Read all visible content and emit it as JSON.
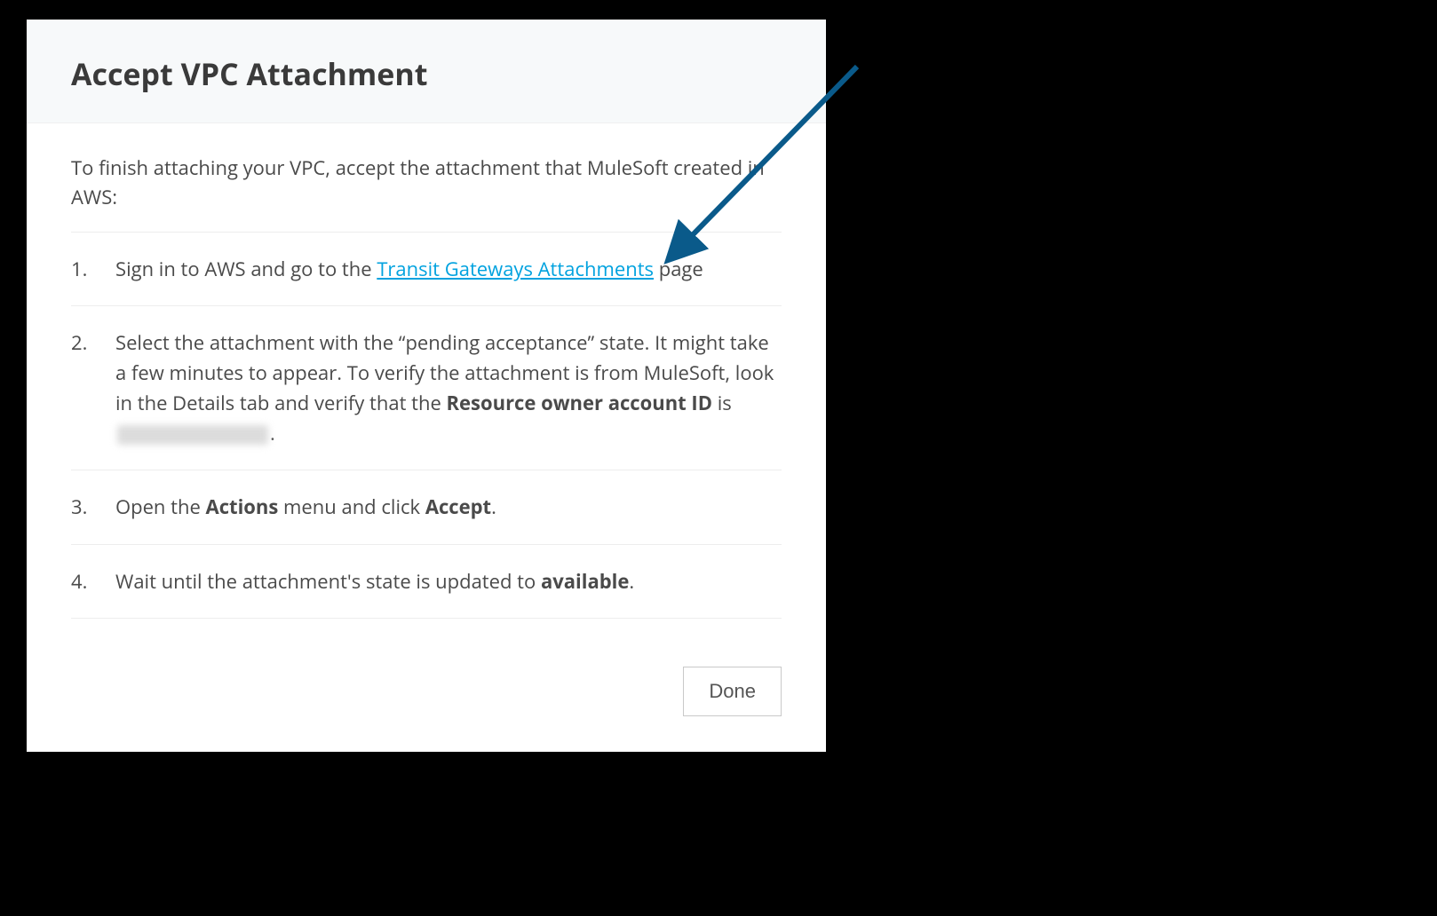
{
  "dialog": {
    "title": "Accept VPC Attachment",
    "intro": "To finish attaching your VPC, accept the attachment that MuleSoft created in AWS:"
  },
  "steps": {
    "s1": {
      "num": "1.",
      "pre": "Sign in to AWS and go to the ",
      "link": "Transit Gateways Attachments",
      "post": " page"
    },
    "s2": {
      "num": "2.",
      "pre": "Select the attachment with the “pending acceptance” state. It might take a few minutes to appear. To verify the attachment is from MuleSoft, look in the Details tab and verify that the ",
      "bold": "Resource owner account ID",
      "mid": " is ",
      "post": "."
    },
    "s3": {
      "num": "3.",
      "pre": "Open the ",
      "bold1": "Actions",
      "mid": " menu and click ",
      "bold2": "Accept",
      "post": "."
    },
    "s4": {
      "num": "4.",
      "pre": "Wait until the attachment's state is updated to ",
      "bold": "available",
      "post": "."
    }
  },
  "footer": {
    "done_label": "Done"
  },
  "annotation": {
    "arrow_color": "#0a5a8a"
  }
}
